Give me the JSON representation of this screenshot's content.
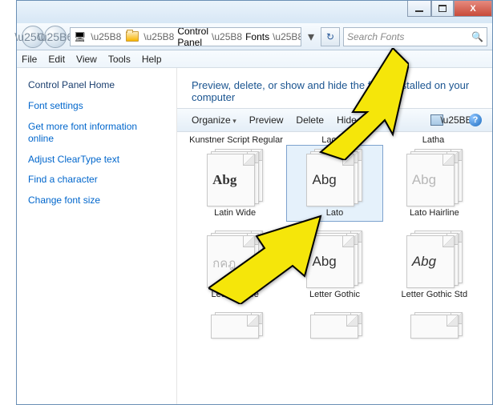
{
  "titlebar": {
    "min": "",
    "max": "",
    "close": "X"
  },
  "breadcrumb": {
    "item1": "All Control Panel Ite...",
    "item2": "Fonts",
    "dd": "▾"
  },
  "search": {
    "placeholder": "Search Fonts"
  },
  "menu": {
    "file": "File",
    "edit": "Edit",
    "view": "View",
    "tools": "Tools",
    "help": "Help"
  },
  "sidebar": {
    "header": "Control Panel Home",
    "links": [
      "Font settings",
      "Get more font information online",
      "Adjust ClearType text",
      "Find a character",
      "Change font size"
    ]
  },
  "heading": "Preview, delete, or show and hide the fonts installed on your computer",
  "toolbar": {
    "organize": "Organize",
    "preview": "Preview",
    "delete": "Delete",
    "hide": "Hide"
  },
  "top_labels": {
    "a": "Kunstner Script Regular",
    "b": "Lao UI",
    "c": "Latha"
  },
  "fonts": [
    {
      "name": "Latin Wide",
      "sample": "Abg",
      "style": "bold",
      "stack": true
    },
    {
      "name": "Lato",
      "sample": "Abg",
      "style": "",
      "stack": true,
      "selected": true
    },
    {
      "name": "Lato Hairline",
      "sample": "Abg",
      "style": "hair",
      "stack": true
    },
    {
      "name": "Leelawadee",
      "sample": "กคฎ",
      "style": "thai hair",
      "stack": true
    },
    {
      "name": "Letter Gothic",
      "sample": "Abg",
      "style": "",
      "stack": true
    },
    {
      "name": "Letter Gothic Std",
      "sample": "Abg",
      "style": "italic",
      "stack": true
    }
  ]
}
